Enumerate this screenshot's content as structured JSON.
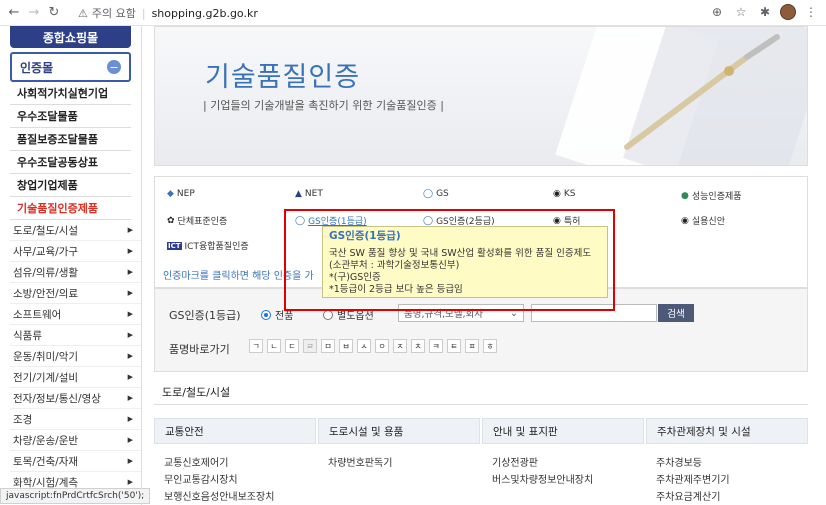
{
  "browser": {
    "security_label": "주의 요함",
    "url": "shopping.g2b.go.kr"
  },
  "sidebar": {
    "top_label": "종합쇼핑몰",
    "section_title": "인증몰",
    "bold_items": [
      {
        "label": "사회적가치실현기업"
      },
      {
        "label": "우수조달물품"
      },
      {
        "label": "품질보증조달물품"
      },
      {
        "label": "우수조달공동상표"
      },
      {
        "label": "창업기업제품"
      },
      {
        "label": "기술품질인증제품"
      }
    ],
    "sub_items": [
      {
        "label": "도로/철도/시설"
      },
      {
        "label": "사무/교육/가구"
      },
      {
        "label": "섬유/의류/생활"
      },
      {
        "label": "소방/안전/의료"
      },
      {
        "label": "소프트웨어"
      },
      {
        "label": "식품류"
      },
      {
        "label": "운동/취미/악기"
      },
      {
        "label": "전기/기계/설비"
      },
      {
        "label": "전자/정보/통신/영상"
      },
      {
        "label": "조경"
      },
      {
        "label": "차량/운송/운반"
      },
      {
        "label": "토목/건축/자재"
      },
      {
        "label": "화학/시험/계측"
      }
    ],
    "accent_color": "#d93025"
  },
  "status_bar": "javascript:fnPrdCrtfcSrch('50');",
  "banner": {
    "title": "기술품질인증",
    "subtitle": "| 기업들의 기술개발을 촉진하기 위한 기술품질인증 |"
  },
  "certifications": [
    {
      "label": "NEP",
      "icon": "nep-logo"
    },
    {
      "label": "NET",
      "icon": "net-logo"
    },
    {
      "label": "GS",
      "icon": "gs-logo"
    },
    {
      "label": "KS",
      "icon": "ks-logo"
    },
    {
      "label": "성능인증제품",
      "icon": "performance-cert-logo"
    },
    {
      "label": "단체표준인증",
      "icon": "group-standard-logo"
    },
    {
      "label": "GS인증(1등급)",
      "icon": "gs1-logo"
    },
    {
      "label": "GS인증(2등급)",
      "icon": "gs2-logo"
    },
    {
      "label": "특허",
      "icon": "patent-logo"
    },
    {
      "label": "실용신안",
      "icon": "utility-model-logo"
    },
    {
      "label": "ICT융합품질인증",
      "icon": "ict-logo"
    }
  ],
  "cert_hint": "인증마크를 클릭하면 해당 인증을 가",
  "tooltip": {
    "title": "GS인증(1등급)",
    "lines": [
      "국산 SW 품질 향상 및 국내 SW산업 활성화를 위한 품질 인증제도",
      "(소관부처 : 과학기술정보통신부)",
      "*(구)GS인증",
      "*1등급이 2등급 보다 높은 등급임"
    ]
  },
  "search": {
    "label": "GS인증(1등급)",
    "radio_all": "전품",
    "radio_other": "별도옵션",
    "select_value": "품명,규격,모델,회사",
    "button": "검색",
    "jamo_label": "품명바로가기",
    "jamo": [
      "ㄱ",
      "ㄴ",
      "ㄷ",
      "ㄹ",
      "ㅁ",
      "ㅂ",
      "ㅅ",
      "ㅇ",
      "ㅈ",
      "ㅊ",
      "ㅋ",
      "ㅌ",
      "ㅍ",
      "ㅎ"
    ]
  },
  "section": {
    "title": "도로/철도/시설",
    "columns": [
      {
        "head": "교통안전",
        "items": [
          "교통신호제어기",
          "무인교통감시장치",
          "보행신호음성안내보조장치"
        ]
      },
      {
        "head": "도로시설 및 용품",
        "items": [
          "차량번호판독기"
        ]
      },
      {
        "head": "안내 및 표지판",
        "items": [
          "기상전광판",
          "버스및차량정보안내장치"
        ]
      },
      {
        "head": "주차관제장치 및 시설",
        "items": [
          "주차경보등",
          "주차관제주변기기",
          "주차요금계산기"
        ]
      }
    ]
  }
}
